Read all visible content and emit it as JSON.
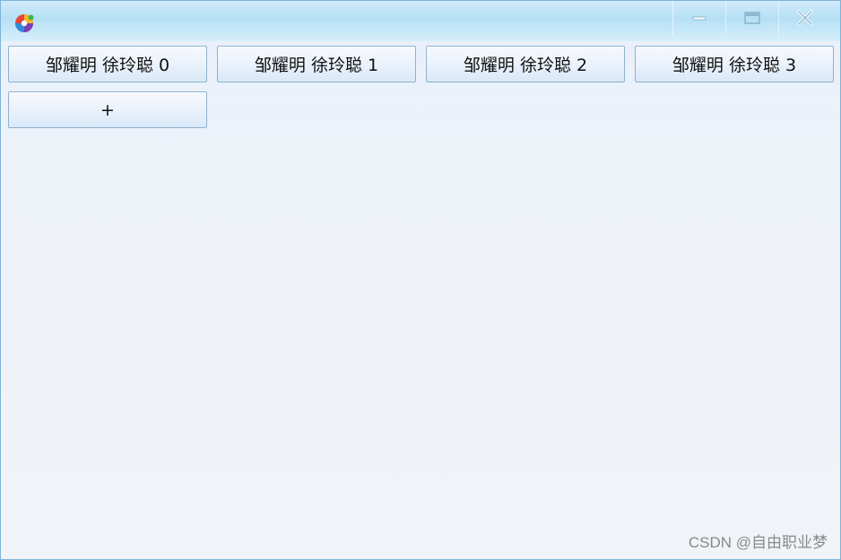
{
  "window": {
    "icon": "colorful-app-icon",
    "controls": {
      "minimize_icon": "minimize-icon",
      "maximize_icon": "maximize-icon",
      "close_icon": "close-icon"
    }
  },
  "buttons": [
    {
      "label": "邹耀明 徐玲聪 0"
    },
    {
      "label": "邹耀明 徐玲聪 1"
    },
    {
      "label": "邹耀明 徐玲聪 2"
    },
    {
      "label": "邹耀明 徐玲聪 3"
    }
  ],
  "add_button": {
    "label": "+"
  },
  "watermark": "CSDN @自由职业梦",
  "colors": {
    "title_bar": "#b6e0f5",
    "window_border": "#7eb4d8",
    "button_border": "#8fb2cc",
    "background": "#f0f3f7"
  }
}
